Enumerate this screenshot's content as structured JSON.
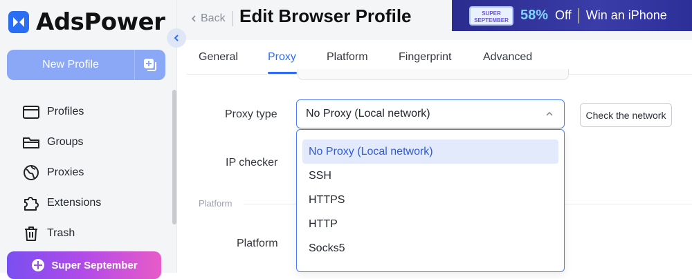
{
  "app": {
    "name": "AdsPower",
    "colors": {
      "brand": "#2a6ff3",
      "accent": "#2f6cf6",
      "primary_button": "#8aa8f5"
    }
  },
  "sidebar": {
    "new_profile_label": "New Profile",
    "items": [
      {
        "label": "Profiles",
        "icon": "profiles-icon"
      },
      {
        "label": "Groups",
        "icon": "folder-icon"
      },
      {
        "label": "Proxies",
        "icon": "globe-icon"
      },
      {
        "label": "Extensions",
        "icon": "puzzle-icon"
      },
      {
        "label": "Trash",
        "icon": "trash-icon"
      }
    ],
    "promo_label": "Super September"
  },
  "header": {
    "back_label": "Back",
    "title": "Edit Browser Profile",
    "banner": {
      "badge_line1": "SUPER",
      "badge_line2": "SEPTEMBER",
      "percent": "58%",
      "off": "Off",
      "win": "Win an iPhone"
    }
  },
  "tabs": [
    {
      "label": "General",
      "active": false
    },
    {
      "label": "Proxy",
      "active": true
    },
    {
      "label": "Platform",
      "active": false
    },
    {
      "label": "Fingerprint",
      "active": false
    },
    {
      "label": "Advanced",
      "active": false
    }
  ],
  "form": {
    "proxy_type_label": "Proxy type",
    "proxy_type_value": "No Proxy (Local network)",
    "check_network_label": "Check the network",
    "ip_checker_label": "IP checker",
    "platform_section": "Platform",
    "platform_label": "Platform"
  },
  "dropdown": {
    "options": [
      {
        "label": "No Proxy (Local network)",
        "selected": true
      },
      {
        "label": "SSH",
        "selected": false
      },
      {
        "label": "HTTPS",
        "selected": false
      },
      {
        "label": "HTTP",
        "selected": false
      },
      {
        "label": "Socks5",
        "selected": false
      }
    ]
  }
}
